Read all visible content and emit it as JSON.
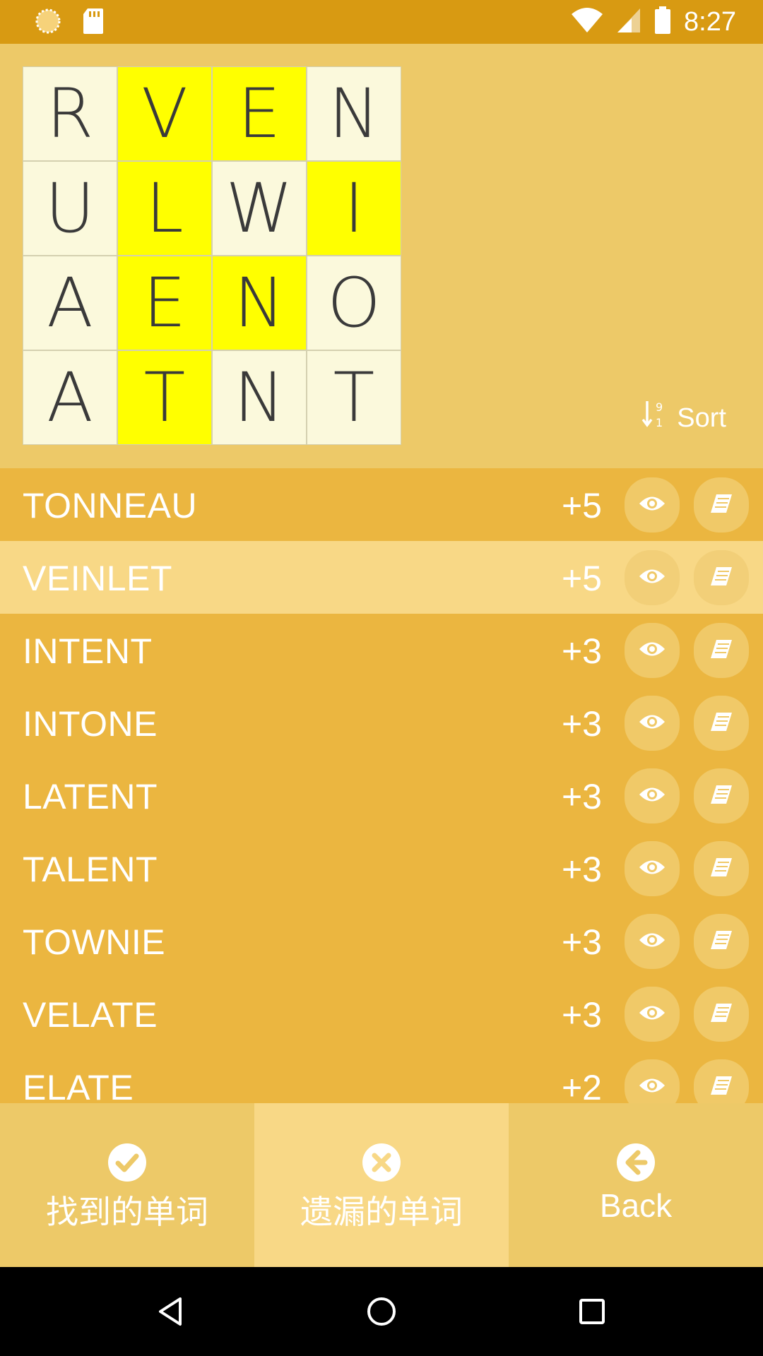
{
  "status_bar": {
    "time": "8:27",
    "icons": [
      "sync-icon",
      "sd-card-icon",
      "wifi-icon",
      "signal-icon",
      "battery-icon"
    ]
  },
  "board": {
    "cells": [
      {
        "letter": "R",
        "highlighted": false
      },
      {
        "letter": "V",
        "highlighted": true
      },
      {
        "letter": "E",
        "highlighted": true
      },
      {
        "letter": "N",
        "highlighted": false
      },
      {
        "letter": "U",
        "highlighted": false
      },
      {
        "letter": "L",
        "highlighted": true
      },
      {
        "letter": "W",
        "highlighted": false
      },
      {
        "letter": "I",
        "highlighted": true
      },
      {
        "letter": "A",
        "highlighted": false
      },
      {
        "letter": "E",
        "highlighted": true
      },
      {
        "letter": "N",
        "highlighted": true
      },
      {
        "letter": "O",
        "highlighted": false
      },
      {
        "letter": "A",
        "highlighted": false
      },
      {
        "letter": "T",
        "highlighted": true
      },
      {
        "letter": "N",
        "highlighted": false
      },
      {
        "letter": "T",
        "highlighted": false
      }
    ],
    "highlight_color": "#ffff00"
  },
  "sort": {
    "label": "Sort",
    "icon": "sort-numeric-icon"
  },
  "words": [
    {
      "word": "TONNEAU",
      "score": "+5",
      "selected": false
    },
    {
      "word": "VEINLET",
      "score": "+5",
      "selected": true
    },
    {
      "word": "INTENT",
      "score": "+3",
      "selected": false
    },
    {
      "word": "INTONE",
      "score": "+3",
      "selected": false
    },
    {
      "word": "LATENT",
      "score": "+3",
      "selected": false
    },
    {
      "word": "TALENT",
      "score": "+3",
      "selected": false
    },
    {
      "word": "TOWNIE",
      "score": "+3",
      "selected": false
    },
    {
      "word": "VELATE",
      "score": "+3",
      "selected": false
    },
    {
      "word": "ELATE",
      "score": "+2",
      "selected": false
    }
  ],
  "tabs": [
    {
      "label": "找到的单词",
      "icon": "check-circle-icon",
      "active": false
    },
    {
      "label": "遗漏的单词",
      "icon": "close-circle-icon",
      "active": true
    },
    {
      "label": "Back",
      "icon": "back-arrow-icon",
      "active": false
    }
  ],
  "colors": {
    "status_bar": "#d89a12",
    "background": "#edc968",
    "list_row": "#ebb640",
    "selected_row": "#f8d886"
  }
}
